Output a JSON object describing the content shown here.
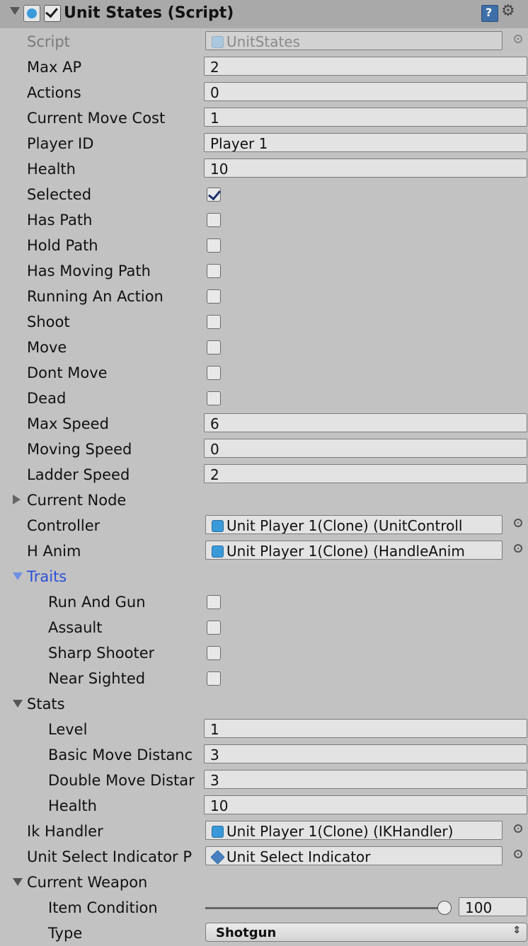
{
  "component": {
    "title": "Unit States (Script)",
    "enabled": true
  },
  "script": {
    "label": "Script",
    "value": "UnitStates"
  },
  "fields": {
    "max_ap": {
      "label": "Max AP",
      "value": "2"
    },
    "actions": {
      "label": "Actions",
      "value": "0"
    },
    "current_move_cost": {
      "label": "Current Move Cost",
      "value": "1"
    },
    "player_id": {
      "label": "Player ID",
      "value": "Player 1"
    },
    "health": {
      "label": "Health",
      "value": "10"
    },
    "max_speed": {
      "label": "Max Speed",
      "value": "6"
    },
    "moving_speed": {
      "label": "Moving Speed",
      "value": "0"
    },
    "ladder_speed": {
      "label": "Ladder Speed",
      "value": "2"
    }
  },
  "toggles": {
    "selected": {
      "label": "Selected",
      "checked": true
    },
    "has_path": {
      "label": "Has Path",
      "checked": false
    },
    "hold_path": {
      "label": "Hold Path",
      "checked": false
    },
    "has_moving_path": {
      "label": "Has Moving Path",
      "checked": false
    },
    "running_an_action": {
      "label": "Running An Action",
      "checked": false
    },
    "shoot": {
      "label": "Shoot",
      "checked": false
    },
    "move": {
      "label": "Move",
      "checked": false
    },
    "dont_move": {
      "label": "Dont Move",
      "checked": false
    },
    "dead": {
      "label": "Dead",
      "checked": false
    }
  },
  "current_node": {
    "label": "Current Node"
  },
  "controller": {
    "label": "Controller",
    "value": "Unit Player 1(Clone) (UnitControll"
  },
  "h_anim": {
    "label": "H Anim",
    "value": "Unit Player 1(Clone) (HandleAnim"
  },
  "traits": {
    "label": "Traits",
    "run_and_gun": {
      "label": "Run And Gun",
      "checked": false
    },
    "assault": {
      "label": "Assault",
      "checked": false
    },
    "sharp_shooter": {
      "label": "Sharp Shooter",
      "checked": false
    },
    "near_sighted": {
      "label": "Near Sighted",
      "checked": false
    }
  },
  "stats": {
    "label": "Stats",
    "level": {
      "label": "Level",
      "value": "1"
    },
    "basic_move_distance": {
      "label": "Basic Move Distanc",
      "value": "3"
    },
    "double_move_distance": {
      "label": "Double Move Distar",
      "value": "3"
    },
    "health": {
      "label": "Health",
      "value": "10"
    }
  },
  "ik_handler": {
    "label": "Ik Handler",
    "value": "Unit Player 1(Clone) (IKHandler)"
  },
  "unit_select_indicator": {
    "label": "Unit Select Indicator P",
    "value": "Unit Select Indicator"
  },
  "current_weapon": {
    "label": "Current Weapon",
    "item_condition": {
      "label": "Item Condition",
      "value": "100",
      "fraction": 1.0
    },
    "type": {
      "label": "Type",
      "value": "Shotgun"
    }
  },
  "icons": {
    "foldout_open": "triangle-down-icon",
    "foldout_closed": "triangle-right-icon",
    "script": "csharp-script-icon",
    "help": "help-book-icon",
    "settings": "gear-icon",
    "object_picker": "object-picker-icon",
    "prefab": "prefab-cube-icon"
  },
  "colors": {
    "background": "#c2c2c2",
    "header": "#a9a9a9",
    "field": "#e3e3e3",
    "accent_blue": "#2a50d8"
  }
}
